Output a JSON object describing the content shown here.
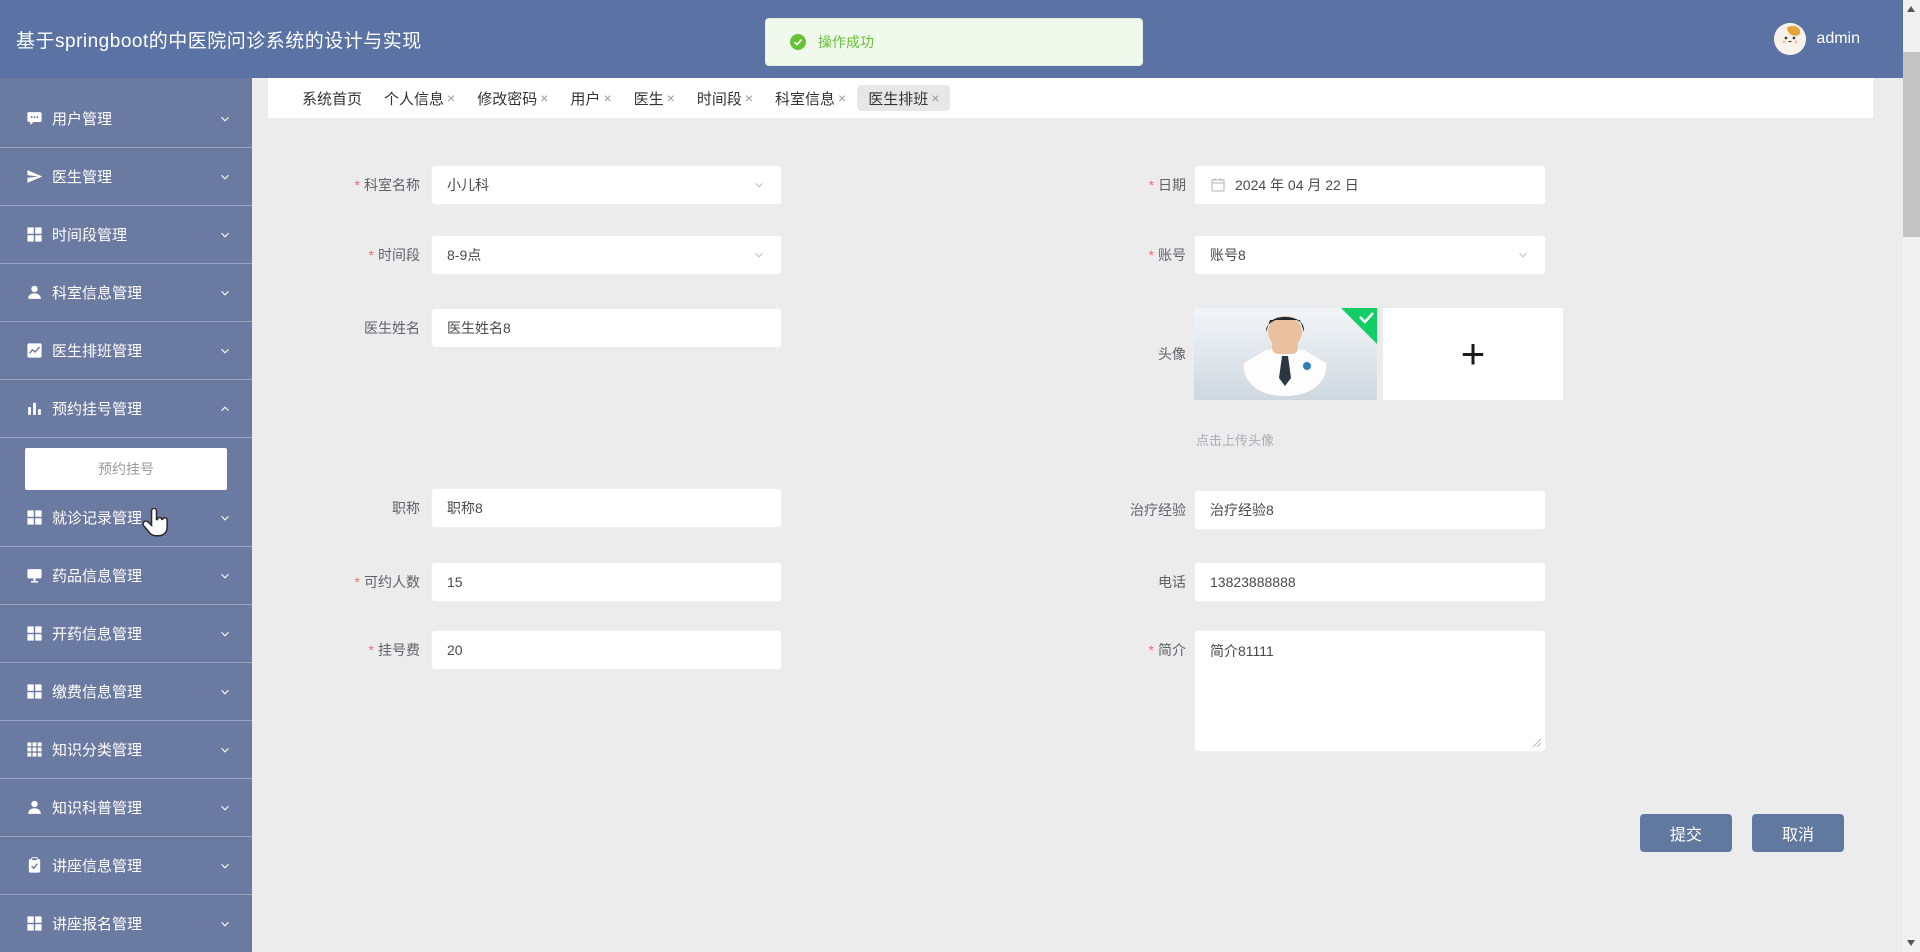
{
  "header": {
    "title": "基于springboot的中医院问诊系统的设计与实现",
    "username": "admin",
    "toast": {
      "text": "操作成功"
    }
  },
  "sidebar": {
    "items": [
      {
        "label": "用户管理",
        "icon": "chat-icon",
        "expanded": false
      },
      {
        "label": "医生管理",
        "icon": "paper-plane-icon",
        "expanded": false
      },
      {
        "label": "时间段管理",
        "icon": "grid-icon",
        "expanded": false
      },
      {
        "label": "科室信息管理",
        "icon": "user-icon",
        "expanded": false
      },
      {
        "label": "医生排班管理",
        "icon": "line-chart-icon",
        "expanded": false
      },
      {
        "label": "预约挂号管理",
        "icon": "bar-chart-icon",
        "expanded": true
      },
      {
        "label": "就诊记录管理",
        "icon": "grid-icon",
        "expanded": false
      },
      {
        "label": "药品信息管理",
        "icon": "monitor-icon",
        "expanded": false
      },
      {
        "label": "开药信息管理",
        "icon": "grid-icon",
        "expanded": false
      },
      {
        "label": "缴费信息管理",
        "icon": "grid-icon",
        "expanded": false
      },
      {
        "label": "知识分类管理",
        "icon": "grid-3x3-icon",
        "expanded": false
      },
      {
        "label": "知识科普管理",
        "icon": "user-icon",
        "expanded": false
      },
      {
        "label": "讲座信息管理",
        "icon": "clipboard-check-icon",
        "expanded": false
      },
      {
        "label": "讲座报名管理",
        "icon": "grid-icon",
        "expanded": false
      }
    ],
    "submenu": {
      "label": "预约挂号"
    }
  },
  "tabs": {
    "close_glyph": "×",
    "items": [
      {
        "label": "系统首页",
        "closable": false,
        "active": false
      },
      {
        "label": "个人信息",
        "closable": true,
        "active": false
      },
      {
        "label": "修改密码",
        "closable": true,
        "active": false
      },
      {
        "label": "用户",
        "closable": true,
        "active": false
      },
      {
        "label": "医生",
        "closable": true,
        "active": false
      },
      {
        "label": "时间段",
        "closable": true,
        "active": false
      },
      {
        "label": "科室信息",
        "closable": true,
        "active": false
      },
      {
        "label": "医生排班",
        "closable": true,
        "active": true
      }
    ]
  },
  "form": {
    "required_marker": "*",
    "fields": {
      "dept": {
        "label": "科室名称",
        "value": "小儿科",
        "required": true,
        "type": "select"
      },
      "timeslot": {
        "label": "时间段",
        "value": "8-9点",
        "required": true,
        "type": "select"
      },
      "doctor_name": {
        "label": "医生姓名",
        "value": "医生姓名8",
        "required": false,
        "type": "text"
      },
      "title": {
        "label": "职称",
        "value": "职称8",
        "required": false,
        "type": "text"
      },
      "quota": {
        "label": "可约人数",
        "value": "15",
        "required": true,
        "type": "text"
      },
      "fee": {
        "label": "挂号费",
        "value": "20",
        "required": true,
        "type": "text"
      },
      "date": {
        "label": "日期",
        "value": "2024 年 04 月 22 日",
        "required": true,
        "type": "date"
      },
      "account": {
        "label": "账号",
        "value": "账号8",
        "required": true,
        "type": "select"
      },
      "avatar": {
        "label": "头像",
        "hint": "点击上传头像",
        "plus_glyph": "+"
      },
      "experience": {
        "label": "治疗经验",
        "value": "治疗经验8",
        "required": false,
        "type": "text"
      },
      "phone": {
        "label": "电话",
        "value": "13823888888",
        "required": false,
        "type": "text"
      },
      "intro": {
        "label": "简介",
        "value": "简介81111",
        "required": true,
        "type": "textarea"
      }
    },
    "actions": {
      "submit": "提交",
      "cancel": "取消"
    }
  },
  "colors": {
    "header_bg": "#5a73a4",
    "sidebar_bg": "#6b7aa0",
    "content_bg": "#ececec",
    "button": "#61789f",
    "toast_bg": "#f0f9eb",
    "toast_green": "#67c23a",
    "required_star": "#f56c6c",
    "upload_badge_green": "#13ce66"
  }
}
